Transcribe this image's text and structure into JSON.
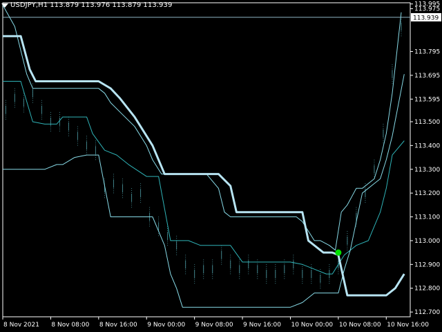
{
  "header": {
    "symbol": "USDJPY,H1",
    "open": "113.879",
    "high": "113.976",
    "low": "113.879",
    "close": "113.939"
  },
  "colors": {
    "background": "#000000",
    "axis": "#ffffff",
    "grid": "#3a3a3a",
    "price_line": "#8fb6c6",
    "price_tag_bg": "#ffffff",
    "price_tag_text": "#000000",
    "thick_line": "#b7e4f2",
    "channel": "#88dbe8",
    "midline": "#2fb3b7",
    "candles": "#3f7f86",
    "signal_dot": "#00e000"
  },
  "chart_data": {
    "type": "line",
    "symbol": "USDJPY",
    "timeframe": "H1",
    "current_price": 113.939,
    "ylim": [
      112.68,
      114.0
    ],
    "xlim": [
      0,
      136
    ],
    "y_ticks": [
      "113.995",
      "113.975",
      "113.795",
      "113.695",
      "113.595",
      "113.500",
      "113.400",
      "113.300",
      "113.200",
      "113.100",
      "113.000",
      "112.900",
      "112.800",
      "112.700"
    ],
    "x_ticks": [
      {
        "label": "8 Nov 2021",
        "x": 0
      },
      {
        "label": "8 Nov 08:00",
        "x": 16
      },
      {
        "label": "8 Nov 16:00",
        "x": 32
      },
      {
        "label": "9 Nov 00:00",
        "x": 48
      },
      {
        "label": "9 Nov 08:00",
        "x": 64
      },
      {
        "label": "9 Nov 16:00",
        "x": 80
      },
      {
        "label": "10 Nov 00:00",
        "x": 96
      },
      {
        "label": "10 Nov 08:00",
        "x": 112
      },
      {
        "label": "10 Nov 16:00",
        "x": 128
      }
    ],
    "series": [
      {
        "role": "thick-line",
        "x": [
          0,
          6,
          9,
          11,
          32,
          36,
          39,
          44,
          50,
          54,
          56,
          72,
          76,
          78,
          100,
          102,
          107,
          110,
          112,
          115,
          128,
          131,
          134
        ],
        "y": [
          113.86,
          113.86,
          113.72,
          113.67,
          113.67,
          113.64,
          113.6,
          113.52,
          113.4,
          113.28,
          113.28,
          113.28,
          113.23,
          113.12,
          113.12,
          113.0,
          112.95,
          112.95,
          112.94,
          112.77,
          112.77,
          112.8,
          112.86
        ]
      },
      {
        "role": "upper-band",
        "x": [
          0,
          4,
          8,
          10,
          14,
          20,
          24,
          28,
          30,
          32,
          34,
          36,
          40,
          44,
          48,
          50,
          53,
          54,
          57,
          62,
          66,
          68,
          72,
          74,
          76,
          78,
          80,
          84,
          88,
          92,
          96,
          98,
          100,
          104,
          106,
          109,
          111,
          113,
          115,
          118,
          120,
          124,
          126,
          128,
          130,
          133
        ],
        "y": [
          113.99,
          113.9,
          113.7,
          113.64,
          113.64,
          113.64,
          113.64,
          113.64,
          113.64,
          113.64,
          113.62,
          113.58,
          113.53,
          113.48,
          113.4,
          113.34,
          113.28,
          113.28,
          113.28,
          113.28,
          113.28,
          113.28,
          113.22,
          113.12,
          113.1,
          113.1,
          113.1,
          113.1,
          113.1,
          113.1,
          113.1,
          113.1,
          113.08,
          113.0,
          113.0,
          112.98,
          112.96,
          113.12,
          113.15,
          113.22,
          113.22,
          113.26,
          113.34,
          113.45,
          113.62,
          113.96
        ]
      },
      {
        "role": "lower-band",
        "x": [
          0,
          8,
          14,
          18,
          20,
          24,
          28,
          30,
          32,
          36,
          44,
          48,
          50,
          54,
          56,
          58,
          60,
          76,
          80,
          84,
          88,
          92,
          96,
          100,
          102,
          104,
          106,
          110,
          112,
          114,
          116,
          120,
          124,
          126,
          128,
          130,
          134
        ],
        "y": [
          113.3,
          113.3,
          113.3,
          113.32,
          113.32,
          113.35,
          113.36,
          113.36,
          113.36,
          113.1,
          113.1,
          113.1,
          113.1,
          112.98,
          112.86,
          112.8,
          112.72,
          112.72,
          112.72,
          112.72,
          112.72,
          112.72,
          112.72,
          112.74,
          112.76,
          112.78,
          112.78,
          112.78,
          112.78,
          112.88,
          112.96,
          113.2,
          113.24,
          113.26,
          113.34,
          113.44,
          113.7
        ]
      },
      {
        "role": "midline",
        "x": [
          0,
          6,
          10,
          14,
          18,
          20,
          24,
          28,
          30,
          34,
          38,
          42,
          48,
          52,
          56,
          62,
          66,
          70,
          76,
          80,
          86,
          92,
          96,
          100,
          104,
          108,
          110,
          112,
          114,
          118,
          122,
          124,
          126,
          128,
          130,
          134
        ],
        "y": [
          113.67,
          113.67,
          113.5,
          113.49,
          113.49,
          113.52,
          113.52,
          113.52,
          113.45,
          113.38,
          113.36,
          113.32,
          113.27,
          113.27,
          113.0,
          113.0,
          112.98,
          112.98,
          112.98,
          112.91,
          112.91,
          112.91,
          112.91,
          112.9,
          112.88,
          112.86,
          112.86,
          112.9,
          112.94,
          112.98,
          113.0,
          113.06,
          113.12,
          113.22,
          113.36,
          113.42
        ]
      },
      {
        "role": "candles",
        "x": [
          1,
          4,
          7,
          10,
          13,
          16,
          19,
          22,
          25,
          28,
          31,
          34,
          37,
          40,
          43,
          46,
          49,
          52,
          55,
          58,
          61,
          64,
          67,
          70,
          73,
          76,
          79,
          82,
          85,
          88,
          91,
          94,
          97,
          100,
          103,
          106,
          109,
          112,
          115,
          118,
          121,
          124,
          127,
          130,
          133
        ],
        "y": [
          113.55,
          113.6,
          113.58,
          113.62,
          113.55,
          113.5,
          113.5,
          113.48,
          113.44,
          113.4,
          113.38,
          113.22,
          113.24,
          113.22,
          113.18,
          113.2,
          113.1,
          113.06,
          113.02,
          112.98,
          112.9,
          112.86,
          112.88,
          112.88,
          112.94,
          112.9,
          112.88,
          112.9,
          112.88,
          112.86,
          112.86,
          112.88,
          112.9,
          112.86,
          112.86,
          112.84,
          112.86,
          112.9,
          113.0,
          113.1,
          113.2,
          113.3,
          113.45,
          113.7,
          113.9
        ]
      }
    ],
    "signal": {
      "x": 112,
      "y": 112.95
    }
  }
}
